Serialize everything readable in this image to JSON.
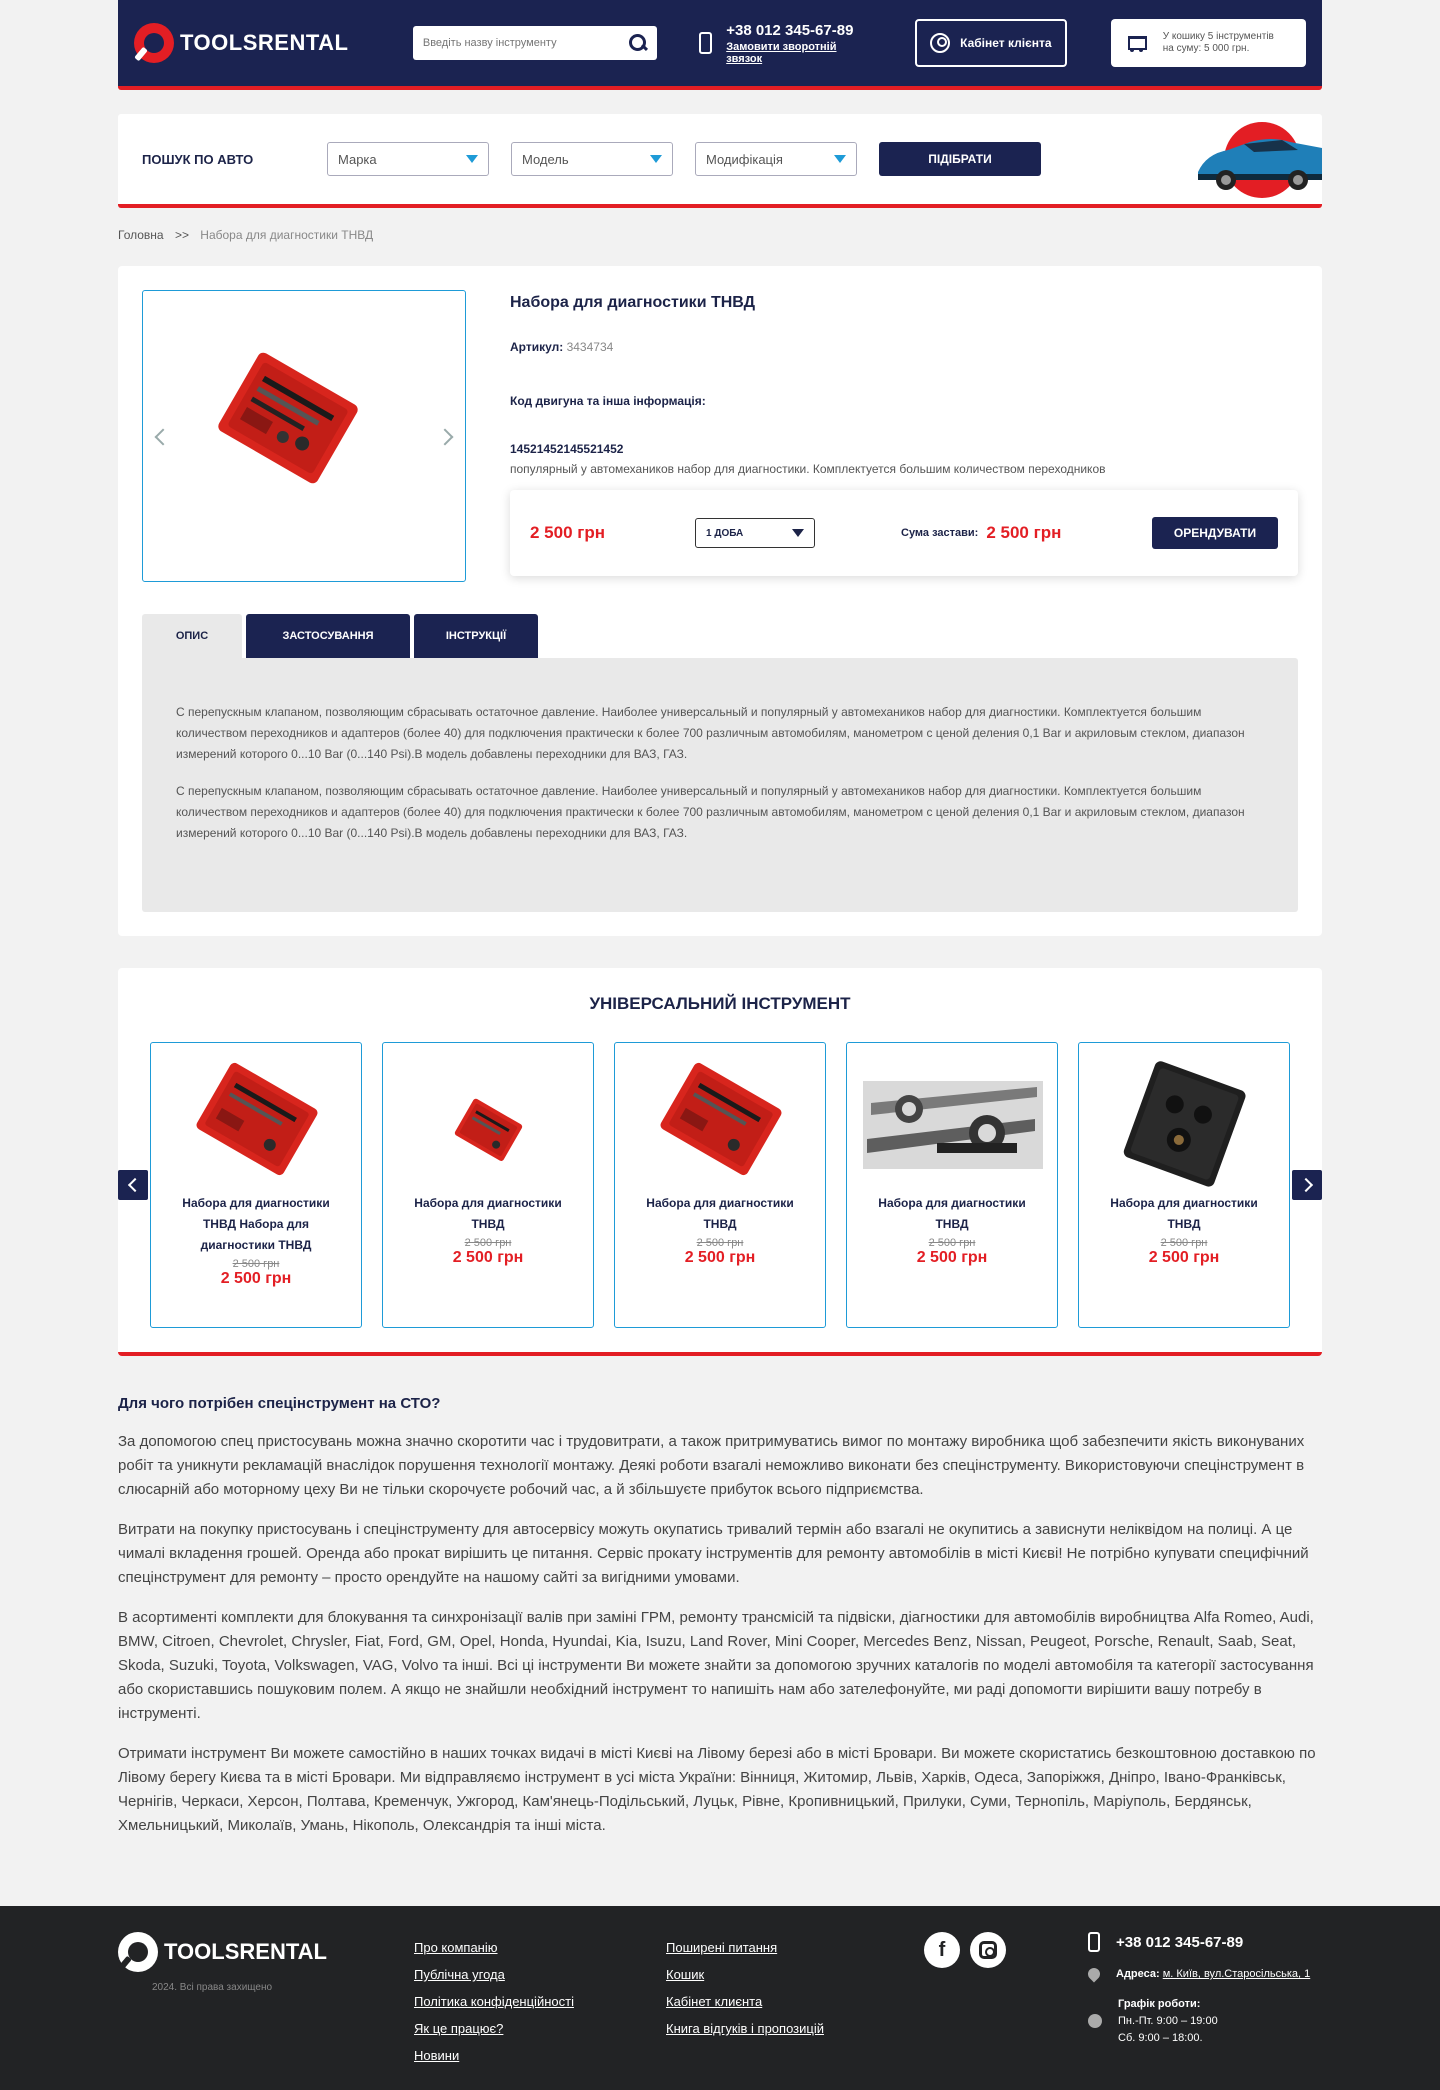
{
  "header": {
    "logo": "TOOLSRENTAL",
    "search_placeholder": "Введіть назву інструменту",
    "phone": "+38 012 345-67-89",
    "callback": "Замовити зворотній звязок",
    "cabinet": "Кабінет клієнта",
    "cart_line1": "У кошику 5 інструментів",
    "cart_line2": "на суму: 5 000 грн."
  },
  "car_search": {
    "title": "ПОШУК ПО АВТО",
    "brand": "Марка",
    "model": "Модель",
    "modification": "Модифікація",
    "submit": "ПІДІБРАТИ"
  },
  "breadcrumb": {
    "home": "Головна",
    "separator": ">>",
    "current": "Набора для диагностики ТНВД"
  },
  "product": {
    "title": "Набора для диагностики ТНВД",
    "sku_label": "Артикул:",
    "sku_value": "3434734",
    "engine_heading": "Код двигуна та інша інформація:",
    "engine_code": "14521452145521452",
    "engine_desc": "популярный у автомехаников набор для диагностики. Комплектуется большим количеством переходников",
    "price": "2 500 грн",
    "duration": "1 ДОБА",
    "deposit_label": "Сума застави:",
    "deposit_value": "2 500 грн",
    "rent_button": "ОРЕНДУВАТИ",
    "tabs": [
      "ОПИС",
      "ЗАСТОСУВАННЯ",
      "ІНСТРУКЦІЇ"
    ],
    "description": [
      "С перепускным клапаном, позволяющим сбрасывать остаточное давление. Наиболее универсальный и популярный у автомехаников набор для диагностики. Комплектуется большим количеством переходников и адаптеров (более 40) для подключения практически к более 700 различным автомобилям, манометром с ценой деления 0,1 Bar и акриловым стеклом, диапазон измерений которого 0...10 Bar (0...140 Psi).В модель добавлены переходники для ВАЗ, ГАЗ.",
      "С перепускным клапаном, позволяющим сбрасывать остаточное давление. Наиболее универсальный и популярный у автомехаников набор для диагностики. Комплектуется большим количеством переходников и адаптеров (более 40) для подключения практически к более 700 различным автомобилям, манометром с ценой деления 0,1 Bar и акриловым стеклом, диапазон измерений которого 0...10 Bar (0...140 Psi).В модель добавлены переходники для ВАЗ, ГАЗ."
    ]
  },
  "related": {
    "title": "УНІВЕРСАЛЬНИЙ ІНСТРУМЕНТ",
    "cards": [
      {
        "name": "Набора для диагностики ТНВД Набора для диагностики ТНВД",
        "old_price": "2 500 грн",
        "price": "2 500 грн",
        "image": "red-toolcase"
      },
      {
        "name": "Набора для диагностики ТНВД",
        "old_price": "2 500 грн",
        "price": "2 500 грн",
        "image": "red-toolcase-small"
      },
      {
        "name": "Набора для диагностики ТНВД",
        "old_price": "2 500 грн",
        "price": "2 500 грн",
        "image": "red-toolcase"
      },
      {
        "name": "Набора для диагностики ТНВД",
        "old_price": "2 500 грн",
        "price": "2 500 грн",
        "image": "wrenches-photo"
      },
      {
        "name": "Набора для диагностики ТНВД",
        "old_price": "2 500 грн",
        "price": "2 500 грн",
        "image": "black-toolcase"
      }
    ]
  },
  "seo": {
    "heading": "Для чого потрібен спецінструмент на СТО?",
    "paragraphs": [
      "За допомогою спец пристосувань можна значно скоротити час і трудовитрати, а також притримуватись вимог по монтажу виробника щоб забезпечити якість виконуваних робіт та уникнути рекламацій внаслідок порушення технології монтажу. Деякі роботи взагалі неможливо виконати без спецінструменту. Використовуючи спецінструмент в слюсарній або моторному цеху Ви не тільки скорочуєте робочий час, а й збільшуєте прибуток всього підприємства.",
      "Витрати на покупку пристосувань і спецінструменту для автосервісу можуть окупатись тривалий термін або взагалі не окупитись а зависнути неліквідом на полиці. А це чималі вкладення грошей. Оренда або прокат вирішить це питання. Сервіс прокату інструментів для ремонту автомобілів в місті Києві! Не потрібно купувати специфічний спецінструмент для ремонту – просто орендуйте на нашому сайті за вигідними умовами.",
      "В асортименті комплекти для блокування та синхронізації валів при заміні ГРМ, ремонту трансмісій та підвіски, діагностики для автомобілів виробництва Alfa Romeo, Audi, BMW, Citroen, Chevrolet, Chrysler, Fiat, Ford, GM, Opel, Honda, Hyundai, Kia, Isuzu, Land Rover, Mini Cooper, Mercedes Benz, Nissan, Peugeot, Porsche, Renault, Saab, Seat, Skoda, Suzuki, Toyota, Volkswagen, VAG, Volvo та інші. Всі ці інструменти Ви можете знайти за допомогою зручних каталогів по моделі автомобіля та категорії застосування або скориставшись пошуковим полем. А якщо не знайшли необхідний інструмент то напишіть нам або зателефонуйте, ми раді допомогти вирішити вашу потребу в інструменті.",
      "Отримати інструмент Ви можете самостійно в наших точках видачі в місті Києві на Лівому березі або в місті Бровари. Ви можете скористатись безкоштовною доставкою по Лівому берегу Києва та в місті Бровари. Ми відправляємо інструмент в усі міста України: Вінниця, Житомир, Львів, Харків, Одеса, Запоріжжя, Дніпро, Івано-Франківськ, Чернігів, Черкаси, Херсон, Полтава, Кременчук, Ужгород, Кам'янець-Подільський, Луцьк, Рівне, Кропивницький, Прилуки, Суми, Тернопіль, Маріуполь, Бердянськ, Хмельницький, Миколаїв, Умань, Нікополь, Олександрія та інші міста."
    ]
  },
  "footer": {
    "logo": "TOOLSRENTAL",
    "copyright": "2024. Всі права захищено",
    "col1": [
      "Про компанію",
      "Публічна угода",
      "Політика конфіденційності",
      "Як це працює?",
      "Новини"
    ],
    "col2": [
      "Поширені питання",
      "Кошик",
      "Кабінет клиєнта",
      "Книга відгуків і пропозицій"
    ],
    "social": [
      "facebook-icon",
      "instagram-icon"
    ],
    "facebook_glyph": "f",
    "phone": "+38 012 345-67-89",
    "address_label": "Адреса:",
    "address_value": "м. Київ, вул.Старосільська, 1",
    "hours_label": "Графік роботи:",
    "hours_weekdays": "Пн.-Пт. 9:00 – 19:00",
    "hours_saturday": "Сб. 9:00 – 18:00."
  },
  "colors": {
    "navy": "#1b2351",
    "red": "#e31e24",
    "accent_blue": "#1e9bd7",
    "footer_bg": "#222325"
  }
}
